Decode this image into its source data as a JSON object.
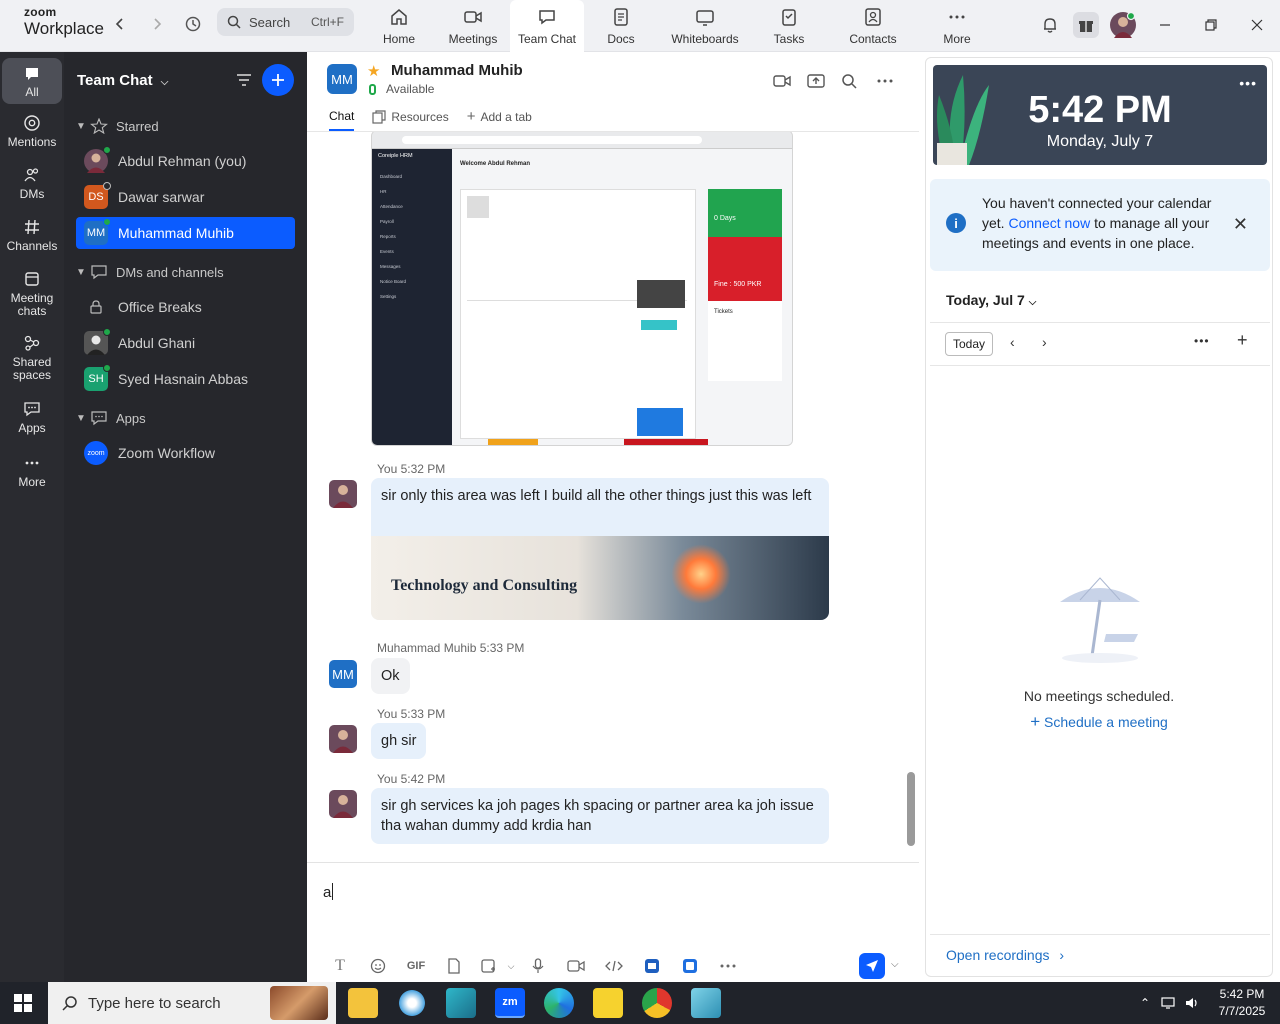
{
  "topbar": {
    "brand_small": "zoom",
    "brand_big": "Workplace",
    "search_label": "Search",
    "search_shortcut": "Ctrl+F",
    "tabs": [
      {
        "label": "Home",
        "icon": "home-icon"
      },
      {
        "label": "Meetings",
        "icon": "video-icon"
      },
      {
        "label": "Team Chat",
        "icon": "chat-icon",
        "active": true
      },
      {
        "label": "Docs",
        "icon": "docs-icon"
      },
      {
        "label": "Whiteboards",
        "icon": "whiteboard-icon"
      },
      {
        "label": "Tasks",
        "icon": "tasks-icon"
      },
      {
        "label": "Contacts",
        "icon": "contacts-icon"
      },
      {
        "label": "More",
        "icon": "more-icon"
      }
    ]
  },
  "rail": [
    {
      "label": "All",
      "icon": "chat-bubble-icon",
      "active": true
    },
    {
      "label": "Mentions",
      "icon": "at-icon"
    },
    {
      "label": "DMs",
      "icon": "people-icon"
    },
    {
      "label": "Channels",
      "icon": "hash-icon"
    },
    {
      "label": "Meeting chats",
      "icon": "calendar-icon"
    },
    {
      "label": "Shared spaces",
      "icon": "share-icon"
    },
    {
      "label": "Apps",
      "icon": "apps-icon"
    },
    {
      "label": "More",
      "icon": "more-icon"
    }
  ],
  "sidebar": {
    "title": "Team Chat",
    "sections": {
      "starred": "Starred",
      "dms": "DMs and channels",
      "apps": "Apps"
    },
    "starred": [
      {
        "name": "Abdul Rehman (you)",
        "initials": "",
        "color": "#6b4a5c",
        "status": "#1fa84a"
      },
      {
        "name": "Dawar sarwar",
        "initials": "DS",
        "color": "#d2581e",
        "status": "#ffffff"
      },
      {
        "name": "Muhammad Muhib",
        "initials": "MM",
        "color": "#1f6fc5",
        "status": "#1fa84a"
      }
    ],
    "dms": [
      {
        "name": "Office Breaks",
        "initials": "",
        "color": "",
        "status": ""
      },
      {
        "name": "Abdul Ghani",
        "initials": "",
        "color": "#555555",
        "status": "#1fa84a"
      },
      {
        "name": "Syed Hasnain Abbas",
        "initials": "SH",
        "color": "#1aa170",
        "status": "#1fa84a"
      }
    ],
    "apps": [
      {
        "name": "Zoom Workflow",
        "initials": "zoom",
        "color": "#0b5cff"
      }
    ]
  },
  "chat": {
    "contact_initials": "MM",
    "contact_name": "Muhammad Muhib",
    "contact_status": "Available",
    "subtabs": [
      "Chat",
      "Resources",
      "Add a tab"
    ],
    "screenshot": {
      "nav_brand": "Coreiple HRM",
      "nav_items": [
        "Dashboard",
        "HR",
        "Attendance",
        "Payroll",
        "Reports",
        "Events",
        "Messages",
        "Notice Board",
        "Settings"
      ],
      "welcome": "Welcome Abdul Rehman",
      "tile_green": "0 Days",
      "tile_red": "Fine : 500 PKR",
      "tickets": "Tickets"
    },
    "messages": [
      {
        "sender": "You",
        "time": "5:32 PM",
        "text": "sir only this area was left  I build all the other things just this was left",
        "banner": "Technology and Consulting"
      },
      {
        "sender": "Muhammad Muhib",
        "time": "5:33 PM",
        "text": "Ok"
      },
      {
        "sender": "You",
        "time": "5:33 PM",
        "text": "gh sir"
      },
      {
        "sender": "You",
        "time": "5:42 PM",
        "text": "sir gh services ka joh pages kh spacing or partner area ka joh issue tha wahan dummy add krdia han"
      }
    ],
    "composer_text": "a",
    "composer_tools": [
      "text-format-icon",
      "emoji-icon",
      "gif-icon",
      "file-icon",
      "screenshot-icon",
      "mic-icon",
      "video-message-icon",
      "code-icon",
      "app-icon",
      "app-icon-2",
      "more-icon"
    ],
    "gif_label": "GIF"
  },
  "right_panel": {
    "time": "5:42 PM",
    "date": "Monday, July 7",
    "notice_text_1": "You haven't connected your calendar yet.",
    "notice_link": "Connect now",
    "notice_text_2": "to manage all your meetings and events in one place.",
    "today_heading": "Today, Jul 7",
    "today_button": "Today",
    "empty_text": "No meetings scheduled.",
    "schedule_link": "Schedule a meeting",
    "recordings_link": "Open recordings"
  },
  "taskbar": {
    "search_placeholder": "Type here to search",
    "clock_time": "5:42 PM",
    "clock_date": "7/7/2025"
  }
}
